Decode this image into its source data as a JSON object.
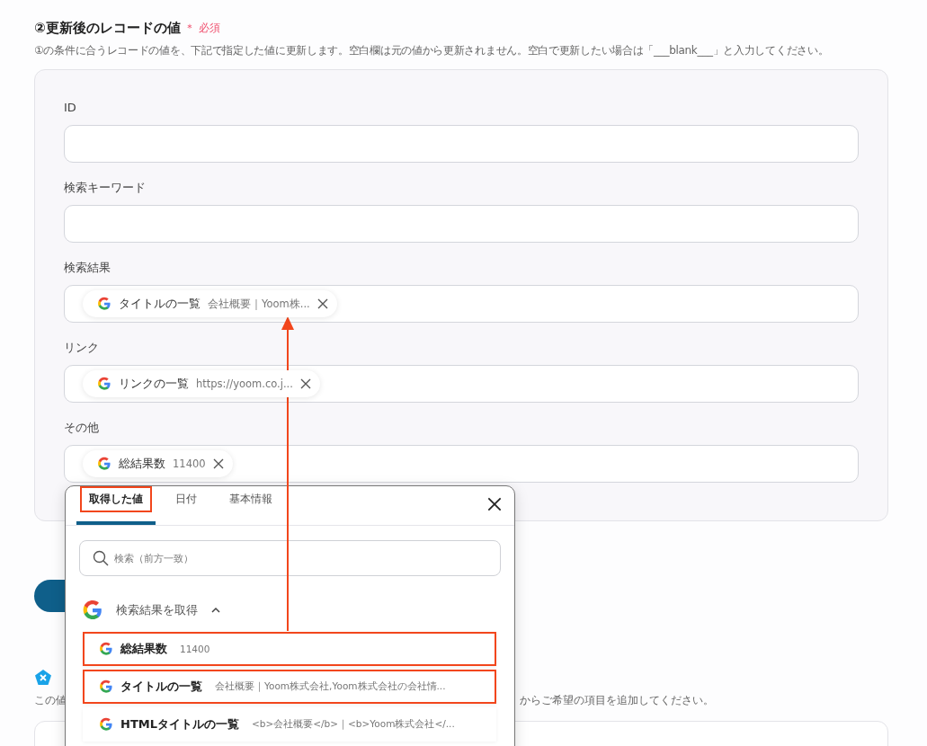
{
  "heading": {
    "title": "②更新後のレコードの値",
    "required_mark": "＊",
    "required": "必須",
    "description": "①の条件に合うレコードの値を、下記で指定した値に更新します。空白欄は元の値から更新されません。空白で更新したい場合は「___blank___」と入力してください。"
  },
  "fields": [
    {
      "label": "ID"
    },
    {
      "label": "検索キーワード"
    },
    {
      "label": "検索結果",
      "chip": {
        "label": "タイトルの一覧",
        "preview": "会社概要｜Yoom株..."
      }
    },
    {
      "label": "リンク",
      "chip": {
        "label": "リンクの一覧",
        "preview": "https://yoom.co.j..."
      }
    },
    {
      "label": "その他",
      "chip": {
        "label": "総結果数",
        "preview": "11400"
      }
    }
  ],
  "next_section": {
    "description_left": "この値",
    "description_right": "からご希望の項目を追加してください。"
  },
  "popup": {
    "tabs": [
      {
        "label": "取得した値",
        "selected": true,
        "highlighted": true
      },
      {
        "label": "日付",
        "selected": false,
        "highlighted": false
      },
      {
        "label": "基本情報",
        "selected": false,
        "highlighted": false
      }
    ],
    "search": {
      "placeholder": "検索（前方一致）"
    },
    "group": {
      "title": "検索結果を取得",
      "expanded": true,
      "items": [
        {
          "label": "総結果数",
          "preview": "11400",
          "highlighted": true
        },
        {
          "label": "タイトルの一覧",
          "preview": "会社概要｜Yoom株式会社,Yoom株式会社の会社情...",
          "highlighted": true
        },
        {
          "label": "HTMLタイトルの一覧",
          "preview": "<b>会社概要</b>｜<b>Yoom株式会社</...",
          "highlighted": false
        }
      ]
    }
  }
}
